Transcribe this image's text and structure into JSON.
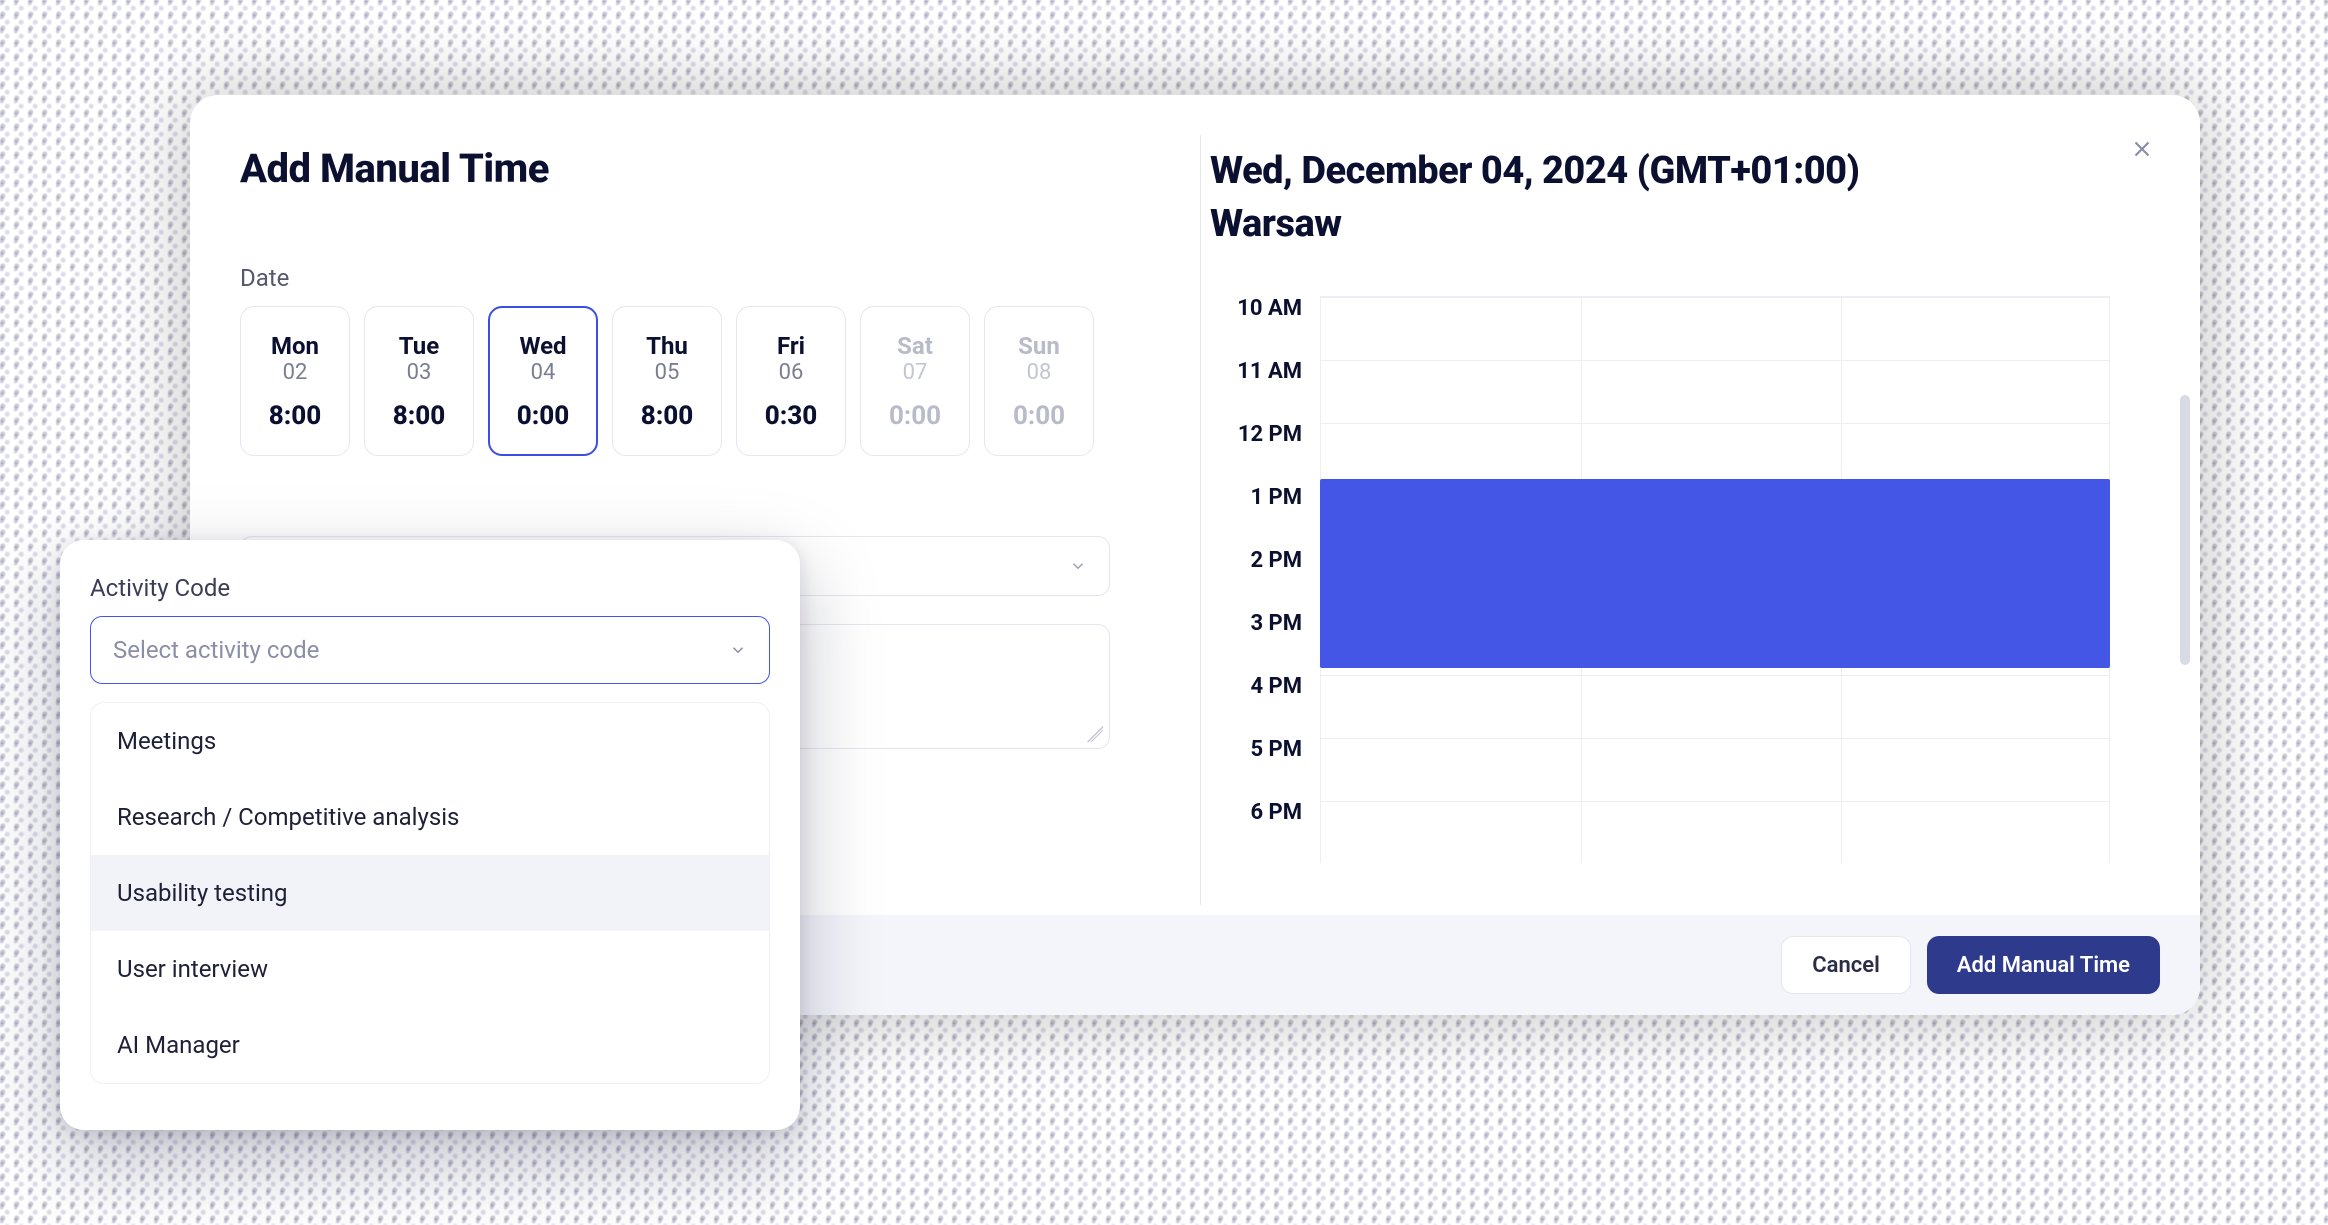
{
  "modal": {
    "title": "Add Manual Time",
    "date_label": "Date",
    "days": [
      {
        "name": "Mon",
        "num": "02",
        "time": "8:00",
        "state": "normal"
      },
      {
        "name": "Tue",
        "num": "03",
        "time": "8:00",
        "state": "normal"
      },
      {
        "name": "Wed",
        "num": "04",
        "time": "0:00",
        "state": "selected"
      },
      {
        "name": "Thu",
        "num": "05",
        "time": "8:00",
        "state": "normal"
      },
      {
        "name": "Fri",
        "num": "06",
        "time": "0:30",
        "state": "normal"
      },
      {
        "name": "Sat",
        "num": "07",
        "time": "0:00",
        "state": "disabled"
      },
      {
        "name": "Sun",
        "num": "08",
        "time": "0:00",
        "state": "disabled"
      }
    ]
  },
  "right": {
    "title": "Wed, December 04, 2024 (GMT+01:00) Warsaw",
    "hours": [
      "10 AM",
      "11 AM",
      "12 PM",
      "1 PM",
      "2 PM",
      "3 PM",
      "4 PM",
      "5 PM",
      "6 PM"
    ],
    "block": {
      "start_index": 2.9,
      "end_index": 5.9
    }
  },
  "footer": {
    "cancel": "Cancel",
    "submit": "Add Manual Time"
  },
  "popover": {
    "label": "Activity Code",
    "placeholder": "Select activity code",
    "options": [
      {
        "label": "Meetings",
        "hover": false
      },
      {
        "label": "Research / Competitive analysis",
        "hover": false
      },
      {
        "label": "Usability testing",
        "hover": true
      },
      {
        "label": "User interview",
        "hover": false
      },
      {
        "label": "AI Manager",
        "hover": false
      }
    ]
  },
  "colors": {
    "accent": "#4456e6",
    "primary_button": "#2e3a8c"
  }
}
